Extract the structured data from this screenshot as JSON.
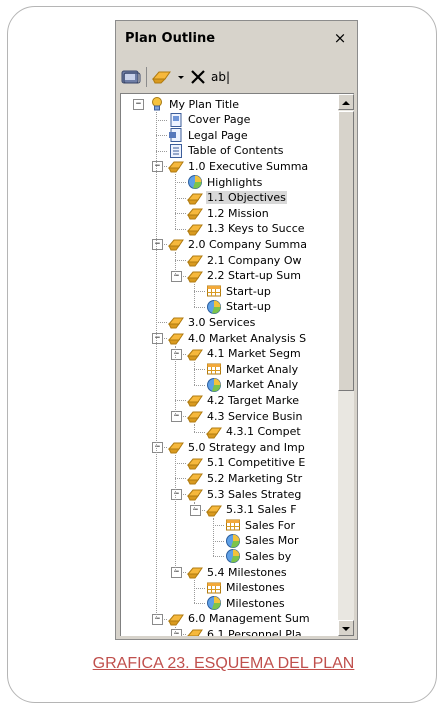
{
  "panel": {
    "title": "Plan Outline",
    "close_label": "×"
  },
  "toolbar": {
    "text_label": "ab|"
  },
  "tree": [
    {
      "label": "My Plan Title",
      "depth": 0,
      "icon": "plan-title-icon",
      "expander": "minus",
      "selected": false
    },
    {
      "label": "Cover Page",
      "depth": 1,
      "icon": "page-icon",
      "expander": null,
      "selected": false
    },
    {
      "label": "Legal Page",
      "depth": 1,
      "icon": "legal-page-icon",
      "expander": null,
      "selected": false
    },
    {
      "label": "Table of Contents",
      "depth": 1,
      "icon": "toc-icon",
      "expander": null,
      "selected": false
    },
    {
      "label": "1.0 Executive Summa",
      "depth": 1,
      "icon": "topic-icon",
      "expander": "minus",
      "selected": false
    },
    {
      "label": "Highlights",
      "depth": 2,
      "icon": "pie-chart-icon",
      "expander": null,
      "selected": false
    },
    {
      "label": "1.1 Objectives",
      "depth": 2,
      "icon": "topic-icon",
      "expander": null,
      "selected": true
    },
    {
      "label": "1.2 Mission",
      "depth": 2,
      "icon": "topic-icon",
      "expander": null,
      "selected": false
    },
    {
      "label": "1.3 Keys to Succe",
      "depth": 2,
      "icon": "topic-icon",
      "expander": null,
      "selected": false
    },
    {
      "label": "2.0 Company Summa",
      "depth": 1,
      "icon": "topic-icon",
      "expander": "minus",
      "selected": false
    },
    {
      "label": "2.1 Company Ow",
      "depth": 2,
      "icon": "topic-icon",
      "expander": null,
      "selected": false
    },
    {
      "label": "2.2 Start-up Sum",
      "depth": 2,
      "icon": "topic-icon",
      "expander": "minus",
      "selected": false
    },
    {
      "label": "Start-up",
      "depth": 3,
      "icon": "table-icon",
      "expander": null,
      "selected": false
    },
    {
      "label": "Start-up",
      "depth": 3,
      "icon": "pie-chart-icon",
      "expander": null,
      "selected": false
    },
    {
      "label": "3.0 Services",
      "depth": 1,
      "icon": "topic-icon",
      "expander": null,
      "selected": false
    },
    {
      "label": "4.0 Market Analysis S",
      "depth": 1,
      "icon": "topic-icon",
      "expander": "minus",
      "selected": false
    },
    {
      "label": "4.1 Market Segm",
      "depth": 2,
      "icon": "topic-icon",
      "expander": "minus",
      "selected": false
    },
    {
      "label": "Market Analy",
      "depth": 3,
      "icon": "table-icon",
      "expander": null,
      "selected": false
    },
    {
      "label": "Market Analy",
      "depth": 3,
      "icon": "pie-chart-icon",
      "expander": null,
      "selected": false
    },
    {
      "label": "4.2 Target Marke",
      "depth": 2,
      "icon": "topic-icon",
      "expander": null,
      "selected": false
    },
    {
      "label": "4.3 Service Busin",
      "depth": 2,
      "icon": "topic-icon",
      "expander": "minus",
      "selected": false
    },
    {
      "label": "4.3.1 Compet",
      "depth": 3,
      "icon": "topic-icon",
      "expander": null,
      "selected": false
    },
    {
      "label": "5.0 Strategy and Imp",
      "depth": 1,
      "icon": "topic-icon",
      "expander": "minus",
      "selected": false
    },
    {
      "label": "5.1 Competitive E",
      "depth": 2,
      "icon": "topic-icon",
      "expander": null,
      "selected": false
    },
    {
      "label": "5.2 Marketing Str",
      "depth": 2,
      "icon": "topic-icon",
      "expander": null,
      "selected": false
    },
    {
      "label": "5.3 Sales Strateg",
      "depth": 2,
      "icon": "topic-icon",
      "expander": "minus",
      "selected": false
    },
    {
      "label": "5.3.1 Sales F",
      "depth": 3,
      "icon": "topic-icon",
      "expander": "minus",
      "selected": false
    },
    {
      "label": "Sales For",
      "depth": 4,
      "icon": "table-icon",
      "expander": null,
      "selected": false
    },
    {
      "label": "Sales Mor",
      "depth": 4,
      "icon": "pie-chart-icon",
      "expander": null,
      "selected": false
    },
    {
      "label": "Sales by",
      "depth": 4,
      "icon": "pie-chart-icon",
      "expander": null,
      "selected": false
    },
    {
      "label": "5.4 Milestones",
      "depth": 2,
      "icon": "topic-icon",
      "expander": "minus",
      "selected": false
    },
    {
      "label": "Milestones",
      "depth": 3,
      "icon": "table-icon",
      "expander": null,
      "selected": false
    },
    {
      "label": "Milestones",
      "depth": 3,
      "icon": "pie-chart-icon",
      "expander": null,
      "selected": false
    },
    {
      "label": "6.0 Management Sum",
      "depth": 1,
      "icon": "topic-icon",
      "expander": "minus",
      "selected": false
    },
    {
      "label": "6.1 Personnel Pla",
      "depth": 2,
      "icon": "topic-icon",
      "expander": "minus",
      "selected": false
    }
  ],
  "caption": "GRAFICA 23. ESQUEMA DEL PLAN",
  "colors": {
    "caption": "#c0504d",
    "panel_bg": "#d7d3cb",
    "topic_icon": "#f6b83c",
    "selection": "#d8d8d8"
  }
}
